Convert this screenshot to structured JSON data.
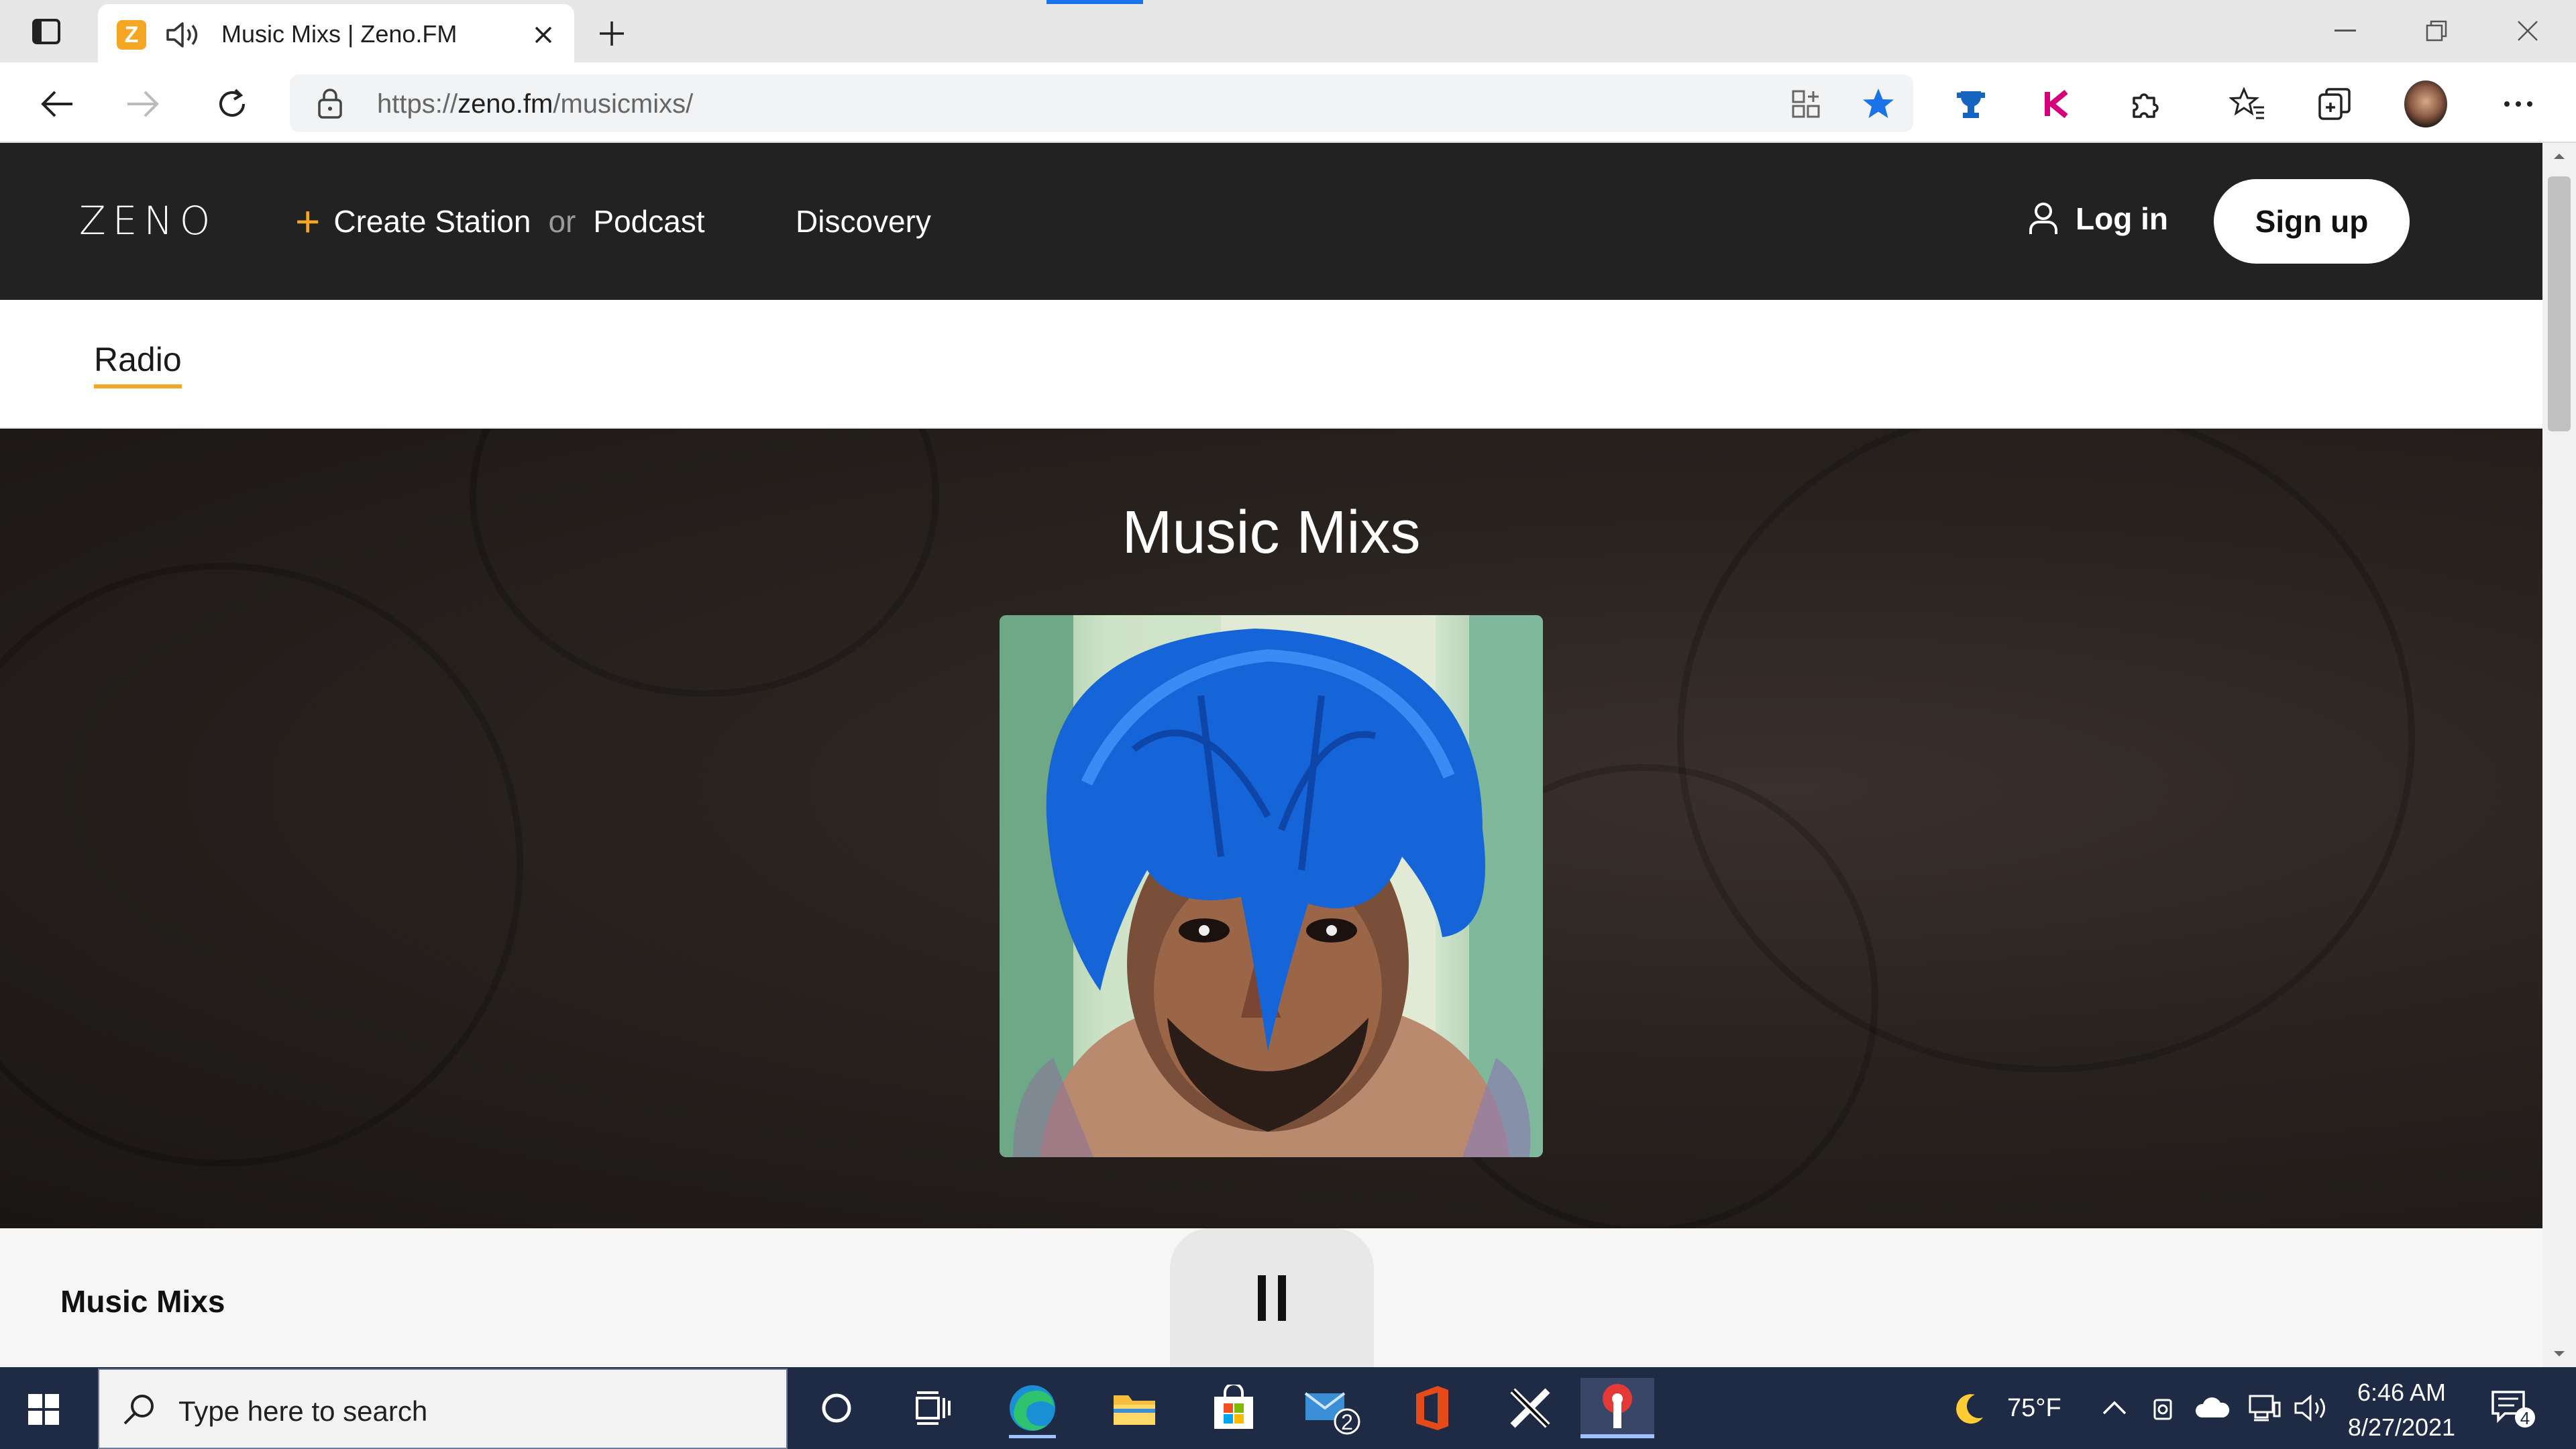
{
  "browser": {
    "tab": {
      "favicon_letter": "Z",
      "title": "Music Mixs | Zeno.FM"
    },
    "address": {
      "protocol": "https://",
      "host": "zeno.fm",
      "path": "/musicmixs/"
    },
    "icons": {
      "back": "back-arrow-icon",
      "forward": "forward-arrow-icon",
      "refresh": "refresh-icon",
      "lock": "lock-icon",
      "favorite": "star-icon",
      "menu": "more-icon"
    }
  },
  "site": {
    "logo": "ZENO",
    "nav": {
      "create_prefix": "+",
      "create_label": "Create Station",
      "or_label": "or",
      "podcast_label": "Podcast",
      "discovery_label": "Discovery",
      "login_label": "Log in",
      "signup_label": "Sign up"
    },
    "subnav": {
      "radio_label": "Radio"
    },
    "hero": {
      "title": "Music Mixs"
    },
    "player": {
      "station_name": "Music Mixs",
      "state": "playing"
    },
    "colors": {
      "accent": "#f5a623",
      "header_bg": "#222222"
    }
  },
  "taskbar": {
    "search_placeholder": "Type here to search",
    "mail_badge": "2",
    "weather_temp": "75°F",
    "time": "6:46 AM",
    "date": "8/27/2021",
    "notification_count": "4"
  }
}
